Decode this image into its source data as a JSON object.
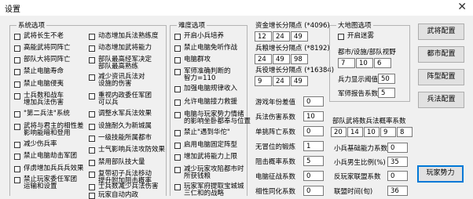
{
  "window": {
    "title": "设置",
    "close_glyph": "✕"
  },
  "system_options": {
    "legend": "系统选项",
    "col1": [
      "武将长生不老",
      "高能武将同阵亡",
      "部队大将同阵亡",
      "禁止电脑寿命",
      "禁止电脑侵夷",
      "士兵数和战车\n增加兵法伤害",
      "\"第二兵法\"系统",
      "武将与君主的相性差\n影响能暗和登用",
      "减少伤兵率",
      "禁止电脑劫击军团",
      "俘虏增加兵兵兵效果",
      "禁止玩家委任军团\n运输和设置"
    ],
    "col2": [
      "动态增加兵法熟练度",
      "动态增加武将能力",
      "部队最高经军决定\n部队最高熟练",
      "减少资讯兵法对\n设施的伤害",
      "重视内政委任军团\n可以兵",
      "调整水军兵法效果",
      "设施耐久为新城属",
      "一级技能所属都市",
      "士气影响兵法攻防效果",
      "禁用部队技大量",
      "复带初子兵法移动\n提升附加阻击概率",
      "士兵数减少兵法伤害",
      "玩家自动内政"
    ]
  },
  "difficulty": {
    "legend": "难度选项",
    "items": [
      "开启小兵培养",
      "禁止电脑免听作战",
      "电脑群攻",
      "军师准确判断的\n智力=110",
      "加强电脑规律收入",
      "允许电脑接力救援",
      "电脑与玩家势力情绪\n的影响坐卧都奉与位置",
      "禁止\"遇到华佗\"",
      "启用电脑固定阵型",
      "增加武将能力上限",
      "减少玩家攻陷都市时\n所获钱粮",
      "玩家军府提取宝城城\n三仁和的战略"
    ]
  },
  "resource": {
    "gold_label": "资金增长分隔点 (*4096)",
    "gold_values": [
      "12",
      "24",
      "49"
    ],
    "food_label": "兵粮增长分隔点 (*8192)",
    "food_values": [
      "24",
      "49",
      "98"
    ],
    "troop_label": "兵役增长分隔点 (*16384)",
    "troop_values": [
      "9",
      "24",
      "49"
    ]
  },
  "params": [
    {
      "label": "游戏年份差值",
      "value": "0"
    },
    {
      "label": "兵法伤害系数",
      "value": "10"
    },
    {
      "label": "单挑阵亡系数",
      "value": "0"
    },
    {
      "label": "无冒位的锻炼",
      "value": "1"
    },
    {
      "label": "阻击概率系数",
      "value": "5"
    },
    {
      "label": "电脑征战系数",
      "value": "0"
    },
    {
      "label": "相性同化系数",
      "value": "0"
    }
  ],
  "bigmap": {
    "legend": "大地图选项",
    "fog_label": "开启迷雾",
    "city_view_label": "都市/设施/部队视野",
    "city_view_values": [
      "7",
      "10",
      "6"
    ],
    "display_label": "兵力显示阈值",
    "display_value": "50",
    "strategist_label": "军师报告系数",
    "strategist_value": "5"
  },
  "tech": {
    "label": "部队武将数兵法概率系数",
    "values": [
      "20",
      "14",
      "10",
      "9",
      "8"
    ]
  },
  "right_params": [
    {
      "label": "小兵基础能力系数",
      "value": "0"
    },
    {
      "label": "小兵男生比例(%)",
      "value": "35"
    },
    {
      "label": "反玩家联盟系数",
      "value": "0"
    },
    {
      "label": "联盟时间(旬)",
      "value": "36"
    }
  ],
  "buttons": {
    "general": "武将配置",
    "city": "都市配置",
    "formation": "阵型配置",
    "tactic": "兵法配置",
    "player": "玩家势力"
  }
}
